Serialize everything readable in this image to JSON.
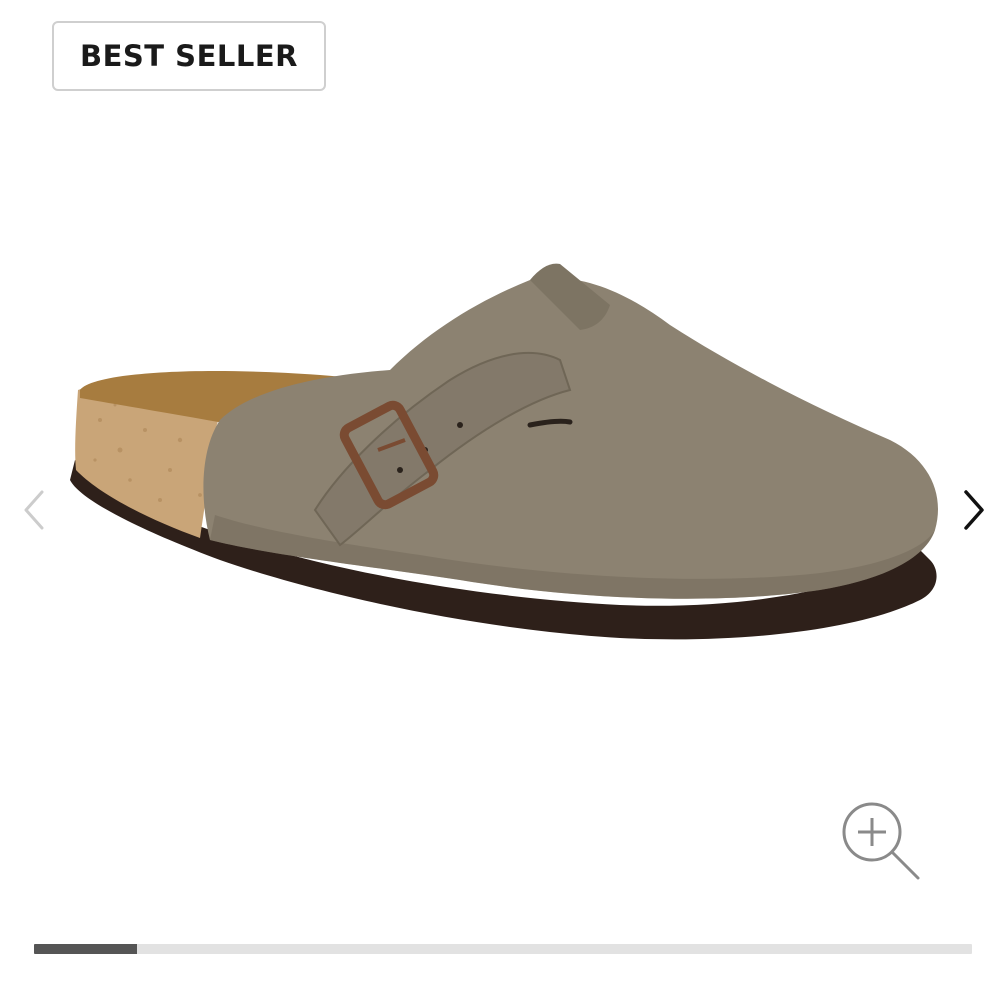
{
  "badge": {
    "label": "BEST SELLER"
  },
  "product": {
    "image_icon": "clog-shoe-image",
    "colors": {
      "suede": "#8c8271",
      "suede_shadow": "#6f6656",
      "cork": "#c9a578",
      "footbed": "#a77c3f",
      "sole": "#2e201a",
      "buckle": "#7a4b32"
    }
  },
  "gallery": {
    "prev_icon": "chevron-left-icon",
    "next_icon": "chevron-right-icon",
    "zoom_icon": "zoom-in-icon",
    "prev_color": "#cccccc",
    "next_color": "#111111",
    "progress": {
      "current_fraction": 0.11
    }
  }
}
